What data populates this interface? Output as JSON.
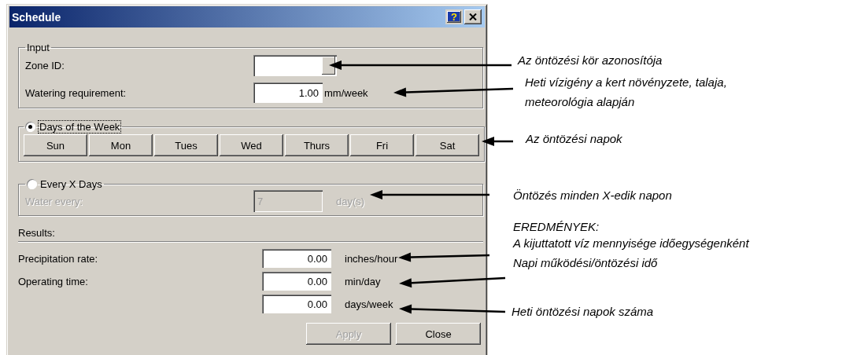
{
  "window": {
    "title": "Schedule",
    "help_button": "?"
  },
  "input_group": {
    "title": "Input",
    "zone_id": {
      "label": "Zone ID:"
    },
    "watering_requirement": {
      "label": "Watering requirement:",
      "value": "1.00",
      "unit": "mm/week"
    }
  },
  "days_of_week": {
    "label": "Days of the Week",
    "selected": true,
    "days": [
      "Sun",
      "Mon",
      "Tues",
      "Wed",
      "Thurs",
      "Fri",
      "Sat"
    ]
  },
  "every_x_days": {
    "label": "Every X Days",
    "selected": false,
    "disabled": true,
    "field_label": "Water every:",
    "value": "7",
    "unit": "day(s)"
  },
  "results": {
    "title": "Results:",
    "rows": [
      {
        "label": "Precipitation rate:",
        "value": "0.00",
        "unit": "inches/hour"
      },
      {
        "label": "Operating time:",
        "value": "0.00",
        "unit": "min/day"
      },
      {
        "value": "0.00",
        "unit": "days/week"
      }
    ]
  },
  "buttons": [
    {
      "label": "Apply",
      "disabled": true
    },
    {
      "label": "Close",
      "disabled": false
    }
  ],
  "annotations": [
    {
      "text": "Az öntözési kör azonosítója"
    },
    {
      "text": "Heti vízigény a kert növényzete, talaja, meteorológia alapján"
    },
    {
      "text": "Az öntözési napok"
    },
    {
      "text": "Öntözés minden X-edik napon"
    },
    {
      "text": "EREDMÉNYEK:"
    },
    {
      "text": "A kijuttatott víz mennyisége időegységenként"
    },
    {
      "text": "Napi működési/öntözési idő"
    },
    {
      "text": "Heti öntözési napok száma"
    }
  ]
}
